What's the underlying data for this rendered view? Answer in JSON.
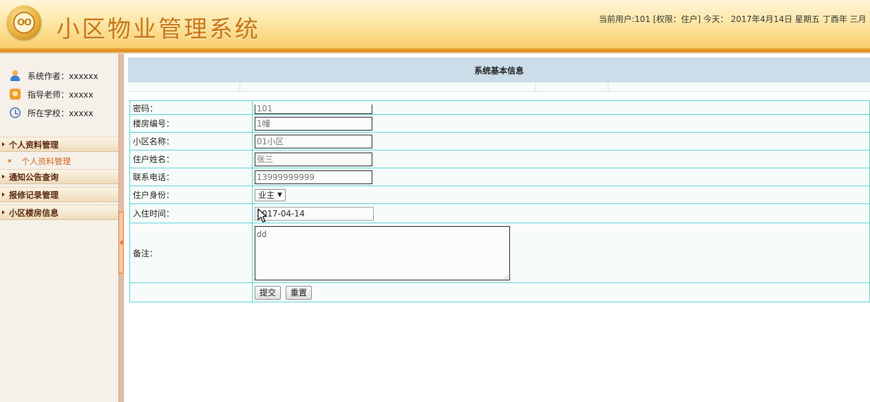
{
  "header": {
    "logo_text": "OO",
    "app_title": "小区物业管理系统",
    "user_info": "当前用户:101 [权限：住户] 今天： 2017年4月14日  星期五  丁酉年 三月"
  },
  "sidebar": {
    "info": [
      {
        "label": "系统作者：xxxxxx"
      },
      {
        "label": "指导老师：xxxxx"
      },
      {
        "label": "所在学校：xxxxx"
      }
    ],
    "menu": [
      {
        "label": "个人资料管理",
        "expanded": true,
        "sub": [
          "个人资料管理"
        ]
      },
      {
        "label": "通知公告查询"
      },
      {
        "label": "报修记录管理"
      },
      {
        "label": "小区楼房信息"
      }
    ]
  },
  "main": {
    "panel_title": "系统基本信息",
    "form": {
      "password": {
        "label": "密码：",
        "value": "101"
      },
      "building": {
        "label": "楼房编号：",
        "value": "1幢"
      },
      "community": {
        "label": "小区名称：",
        "value": "01小区"
      },
      "name": {
        "label": "住户姓名：",
        "value": "张三"
      },
      "phone": {
        "label": "联系电话：",
        "value": "13999999999"
      },
      "identity": {
        "label": "住户身份：",
        "value": "业主"
      },
      "checkin": {
        "label": "入住时间：",
        "value": "2017-04-14"
      },
      "remark": {
        "label": "备注：",
        "value": "dd"
      },
      "submit_label": "提交",
      "reset_label": "重置"
    }
  },
  "colors": {
    "title_orange": "#c77515",
    "menu_text": "#5a2a10",
    "sub_menu_text": "#d2691e",
    "table_border": "#56d0d6",
    "panel_header_bg": "#cadde9"
  }
}
